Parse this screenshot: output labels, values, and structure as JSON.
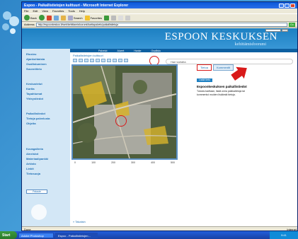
{
  "window": {
    "title": "Espoo - Paikallistietojen kulttuuri - Microsoft Internet Explorer",
    "menu": [
      "File",
      "Edit",
      "View",
      "Favorites",
      "Tools",
      "Help"
    ]
  },
  "toolbar": {
    "back_label": "Back",
    "search_label": "Search",
    "favorites_label": "Favorites"
  },
  "address": {
    "label": "Address",
    "value": "http://espoonkeskus.fi/web/kehittamisfoorumi/karttapalvelu/paikallistietoja",
    "go_label": "Go"
  },
  "banner": {
    "title": "ESPOON KESKUKSEN",
    "subtitle": "kehittämisfoorumi"
  },
  "navstrip": [
    "Palvelut",
    "Alueet",
    "Hanke",
    "Osallistu"
  ],
  "leftnav": {
    "group1": [
      "Etusivu",
      "Ajankohtaista",
      "Osallistuminen",
      "Suunnittelu"
    ],
    "group2": [
      "Keskustelut",
      "Kartta",
      "Tapahtumat",
      "Yhteystiedot"
    ],
    "group3": [
      "Paikallistiedot",
      "Tietoja palvelusta",
      "Ohjeita"
    ],
    "group4": [
      "Kuvagalleria",
      "Aineistot",
      "Materiaalipankki",
      "Arkisto",
      "Linkit",
      "Tietosuoja"
    ],
    "button": "Palaute"
  },
  "main": {
    "breadcrumb": "Paikallistietojen kulttuuri",
    "search_placeholder": "Hae kartalta",
    "scale": [
      "0",
      "100",
      "200",
      "300",
      "400",
      "500"
    ],
    "tabs": [
      "Tietoa",
      "Kommentit"
    ],
    "panel_button": "Lisää tieto",
    "panel_title": "Espoonkeskuksen paikallistiedot",
    "panel_body": "Tutustu karttaan, lisää omia paikkatietoja tai kommentoi muiden lisäämiä tietoja.",
    "bottom_link": "» Takaisin"
  },
  "status": {
    "text": "Done",
    "zone": "Internet"
  },
  "taskbar": {
    "start": "Start",
    "tasks": [
      "Adobe Photoshop",
      "Espoo - Paikallistietojen..."
    ],
    "clock": "9:41"
  }
}
